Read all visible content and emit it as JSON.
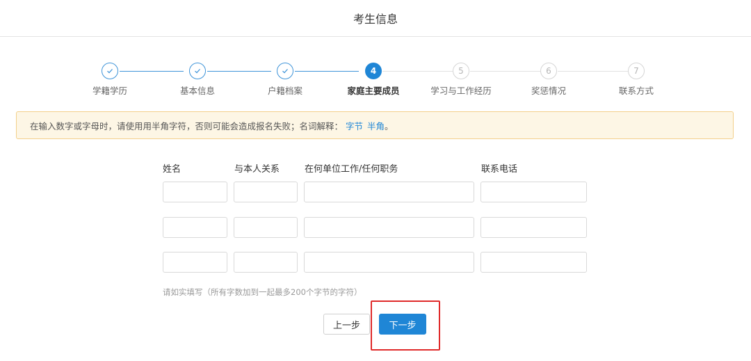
{
  "header": {
    "title": "考生信息"
  },
  "steps": [
    {
      "number": "1",
      "label": "学籍学历",
      "status": "done"
    },
    {
      "number": "2",
      "label": "基本信息",
      "status": "done"
    },
    {
      "number": "3",
      "label": "户籍档案",
      "status": "done"
    },
    {
      "number": "4",
      "label": "家庭主要成员",
      "status": "current"
    },
    {
      "number": "5",
      "label": "学习与工作经历",
      "status": "todo"
    },
    {
      "number": "6",
      "label": "奖惩情况",
      "status": "todo"
    },
    {
      "number": "7",
      "label": "联系方式",
      "status": "todo"
    }
  ],
  "notice": {
    "text": "在输入数字或字母时，请使用用半角字符，否则可能会造成报名失败；名词解释：",
    "link1": "字节",
    "link2": "半角",
    "end": "。"
  },
  "form": {
    "columns": [
      "姓名",
      "与本人关系",
      "在何单位工作/任何职务",
      "联系电话"
    ],
    "hint": "请如实填写（所有字数加到一起最多200个字节的字符）"
  },
  "buttons": {
    "prev": "上一步",
    "next": "下一步"
  },
  "colors": {
    "primary": "#1f86d6",
    "highlight": "#e02a2a",
    "notice_bg": "#fdf6e5"
  },
  "icons": {
    "done": "check-icon"
  }
}
